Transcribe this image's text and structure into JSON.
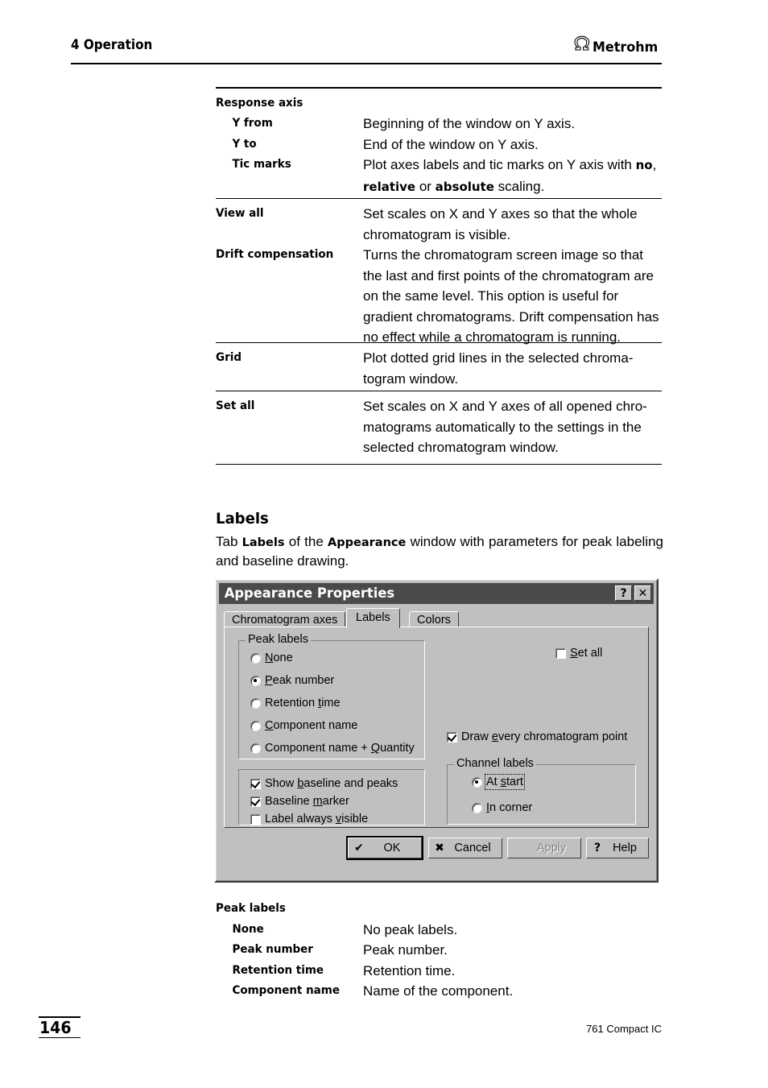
{
  "header": {
    "chapter": "4 Operation",
    "brand": "Metrohm",
    "brand_mark": "omega-logo-icon"
  },
  "tables": [
    {
      "group_heading": "Response axis",
      "rows": [
        {
          "term": "Y from",
          "indent": true,
          "desc": "Beginning of the window on Y axis."
        },
        {
          "term": "Y to",
          "indent": true,
          "desc": "End of the window on Y axis."
        },
        {
          "term": "Tic marks",
          "indent": true,
          "desc": "Plot axes labels and tic marks on Y axis with <b>no</b>, <b>relative</b> or <b>absolute</b> scaling."
        }
      ]
    },
    {
      "rows": [
        {
          "term": "View all",
          "indent": false,
          "desc": "Set scales on X and Y axes so that the whole chromatogram is visible."
        },
        {
          "term": "Drift compensation",
          "indent": false,
          "desc": "Turns the chromatogram screen image so that the last and first points of the chromatogram are on the same level. This option is useful for gradient chromatograms. Drift compensation has no effect while a chromatogram is running."
        }
      ]
    },
    {
      "rows": [
        {
          "term": "Grid",
          "indent": false,
          "desc": "Plot dotted grid lines in the selected chroma-<br>togram window."
        }
      ]
    },
    {
      "rows": [
        {
          "term": "Set all",
          "indent": false,
          "desc": "Set scales on X and Y axes of all opened chro-<br>matograms automatically to the settings in the selected chromatogram window."
        }
      ]
    }
  ],
  "section": {
    "title": "Labels",
    "paragraph": "Tab <b>Labels</b> of the <b>Appearance</b> window with parameters for peak labeling and baseline drawing."
  },
  "dialog": {
    "title": "Appearance Properties",
    "title_buttons": [
      {
        "name": "help-title-button",
        "glyph": "?"
      },
      {
        "name": "close-title-button",
        "glyph": "✕"
      }
    ],
    "tabs": [
      {
        "label": "Chromatogram axes",
        "active": false
      },
      {
        "label": "Labels",
        "active": true
      },
      {
        "label": "Colors",
        "active": false
      }
    ],
    "peak_labels": {
      "legend": "Peak labels",
      "options": [
        {
          "label": "None",
          "accel": "N",
          "selected": false
        },
        {
          "label": "Peak number",
          "accel": "P",
          "selected": true
        },
        {
          "label": "Retention time",
          "accel": "t",
          "selected": false
        },
        {
          "label": "Component name",
          "accel": "C",
          "selected": false
        },
        {
          "label": "Component name + Quantity",
          "accel": "Q",
          "selected": false
        }
      ]
    },
    "baseline_checks": [
      {
        "label": "Show baseline and peaks",
        "accel": "b",
        "checked": true
      },
      {
        "label": "Baseline marker",
        "accel": "m",
        "checked": true
      },
      {
        "label": "Label always visible",
        "accel": "v",
        "checked": false
      }
    ],
    "set_all": {
      "label": "Set all",
      "accel": "S",
      "checked": false
    },
    "draw_every_point": {
      "label": "Draw every chromatogram point",
      "accel": "e",
      "checked": true
    },
    "channel_labels": {
      "legend": "Channel labels",
      "options": [
        {
          "label": "At start",
          "accel": "s",
          "selected": true,
          "focused": true
        },
        {
          "label": "In corner",
          "accel": "I",
          "selected": false,
          "focused": false
        }
      ]
    },
    "buttons": [
      {
        "label": "OK",
        "icon": "check-icon",
        "glyph": "✔",
        "state": "default"
      },
      {
        "label": "Cancel",
        "icon": "cross-icon",
        "glyph": "✖",
        "state": "enabled"
      },
      {
        "label": "Apply",
        "icon": "",
        "glyph": "",
        "state": "disabled"
      },
      {
        "label": "Help",
        "icon": "question-icon",
        "glyph": "?",
        "state": "enabled"
      }
    ]
  },
  "bottom_table": {
    "group_heading": "Peak labels",
    "rows": [
      {
        "term": "None",
        "desc": "No peak labels."
      },
      {
        "term": "Peak number",
        "desc": "Peak number."
      },
      {
        "term": "Retention time",
        "desc": "Retention time."
      },
      {
        "term": "Component name",
        "desc": "Name of the component."
      }
    ]
  },
  "footer": {
    "page_number": "146",
    "document": "761 Compact IC"
  }
}
